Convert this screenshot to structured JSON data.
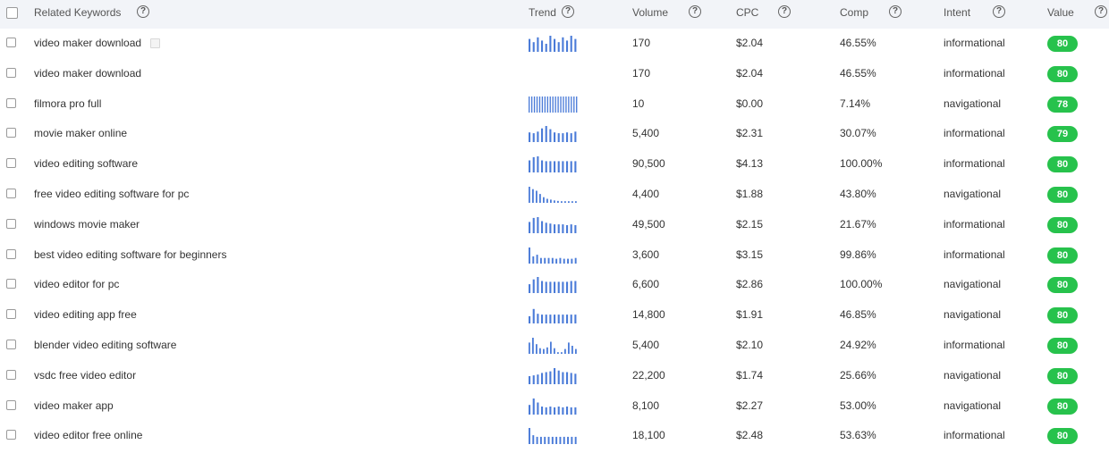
{
  "header": {
    "keyword": "Related Keywords",
    "trend": "Trend",
    "volume": "Volume",
    "cpc": "CPC",
    "comp": "Comp",
    "intent": "Intent",
    "value": "Value",
    "help_glyph": "?"
  },
  "colors": {
    "trend_bar": "#4a7bd8",
    "badge_green": "#27c24c",
    "header_bg": "#f2f4f8"
  },
  "rows": [
    {
      "keyword": "video maker download",
      "volume": "170",
      "cpc": "$2.04",
      "comp": "46.55%",
      "intent": "informational",
      "value": "80",
      "trend": [
        0.8,
        0.6,
        0.9,
        0.7,
        0.5,
        1.0,
        0.8,
        0.6,
        0.9,
        0.7,
        1.0,
        0.8
      ],
      "copy_icon": true
    },
    {
      "keyword": "video maker download",
      "volume": "170",
      "cpc": "$2.04",
      "comp": "46.55%",
      "intent": "informational",
      "value": "80",
      "trend": []
    },
    {
      "keyword": "filmora pro full",
      "volume": "10",
      "cpc": "$0.00",
      "comp": "7.14%",
      "intent": "navigational",
      "value": "78",
      "trend": [
        1,
        1,
        1,
        1,
        1,
        1,
        1,
        1,
        1,
        1,
        1,
        1,
        1,
        1,
        1,
        1,
        1,
        1,
        1
      ]
    },
    {
      "keyword": "movie maker online",
      "volume": "5,400",
      "cpc": "$2.31",
      "comp": "30.07%",
      "intent": "informational",
      "value": "79",
      "trend": [
        0.6,
        0.55,
        0.65,
        0.85,
        1.0,
        0.8,
        0.6,
        0.55,
        0.55,
        0.6,
        0.55,
        0.65
      ]
    },
    {
      "keyword": "video editing software",
      "volume": "90,500",
      "cpc": "$4.13",
      "comp": "100.00%",
      "intent": "informational",
      "value": "80",
      "trend": [
        0.75,
        0.95,
        1.0,
        0.75,
        0.7,
        0.7,
        0.7,
        0.7,
        0.7,
        0.7,
        0.7,
        0.7
      ]
    },
    {
      "keyword": "free video editing software for pc",
      "volume": "4,400",
      "cpc": "$1.88",
      "comp": "43.80%",
      "intent": "navigational",
      "value": "80",
      "trend": [
        1.0,
        0.85,
        0.75,
        0.55,
        0.35,
        0.25,
        0.2,
        0.15,
        0.12,
        0.1,
        0.1,
        0.1,
        0.1,
        0.1
      ]
    },
    {
      "keyword": "windows movie maker",
      "volume": "49,500",
      "cpc": "$2.15",
      "comp": "21.67%",
      "intent": "informational",
      "value": "80",
      "trend": [
        0.7,
        0.95,
        1.0,
        0.75,
        0.65,
        0.6,
        0.55,
        0.55,
        0.55,
        0.5,
        0.55,
        0.5
      ]
    },
    {
      "keyword": "best video editing software for beginners",
      "volume": "3,600",
      "cpc": "$3.15",
      "comp": "99.86%",
      "intent": "informational",
      "value": "80",
      "trend": [
        1.0,
        0.45,
        0.55,
        0.35,
        0.35,
        0.35,
        0.35,
        0.3,
        0.35,
        0.3,
        0.3,
        0.3,
        0.35
      ]
    },
    {
      "keyword": "video editor for pc",
      "volume": "6,600",
      "cpc": "$2.86",
      "comp": "100.00%",
      "intent": "navigational",
      "value": "80",
      "trend": [
        0.55,
        0.85,
        1.0,
        0.75,
        0.7,
        0.7,
        0.7,
        0.7,
        0.7,
        0.7,
        0.75,
        0.75
      ]
    },
    {
      "keyword": "video editing app free",
      "volume": "14,800",
      "cpc": "$1.91",
      "comp": "46.85%",
      "intent": "navigational",
      "value": "80",
      "trend": [
        0.45,
        0.9,
        0.6,
        0.55,
        0.55,
        0.55,
        0.55,
        0.55,
        0.55,
        0.55,
        0.55,
        0.55
      ]
    },
    {
      "keyword": "blender video editing software",
      "volume": "5,400",
      "cpc": "$2.10",
      "comp": "24.92%",
      "intent": "informational",
      "value": "80",
      "trend": [
        0.7,
        1.0,
        0.6,
        0.35,
        0.3,
        0.4,
        0.75,
        0.35,
        0.1,
        0.1,
        0.3,
        0.7,
        0.5,
        0.3
      ]
    },
    {
      "keyword": "vsdc free video editor",
      "volume": "22,200",
      "cpc": "$1.74",
      "comp": "25.66%",
      "intent": "navigational",
      "value": "80",
      "trend": [
        0.5,
        0.55,
        0.6,
        0.7,
        0.75,
        0.8,
        1.0,
        0.85,
        0.75,
        0.75,
        0.7,
        0.65
      ]
    },
    {
      "keyword": "video maker app",
      "volume": "8,100",
      "cpc": "$2.27",
      "comp": "53.00%",
      "intent": "navigational",
      "value": "80",
      "trend": [
        0.6,
        1.0,
        0.75,
        0.5,
        0.45,
        0.5,
        0.45,
        0.5,
        0.45,
        0.5,
        0.45,
        0.45
      ]
    },
    {
      "keyword": "video editor free online",
      "volume": "18,100",
      "cpc": "$2.48",
      "comp": "53.63%",
      "intent": "informational",
      "value": "80",
      "trend": [
        1.0,
        0.55,
        0.45,
        0.45,
        0.45,
        0.45,
        0.45,
        0.45,
        0.45,
        0.45,
        0.45,
        0.45,
        0.45
      ]
    }
  ]
}
